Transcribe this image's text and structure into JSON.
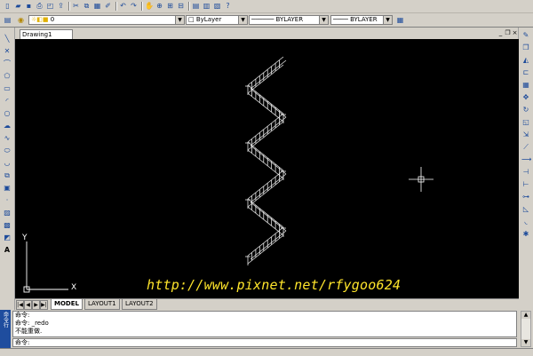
{
  "toolbar": {
    "standard_icons": [
      "new-file-icon",
      "open-icon",
      "save-icon",
      "print-icon",
      "preview-icon",
      "publish-icon",
      "cut-icon",
      "copy-icon",
      "paste-icon",
      "match-properties-icon",
      "undo-icon",
      "redo-icon",
      "pan-icon",
      "zoom-realtime-icon",
      "zoom-window-icon",
      "zoom-previous-icon",
      "properties-icon",
      "design-center-icon",
      "tool-palettes-icon",
      "help-icon"
    ]
  },
  "properties": {
    "layer_value": "0",
    "color_value": "ByLayer",
    "linetype_value": "BYLAYER",
    "lineweight_value": "BYLAYER"
  },
  "drawing_tab": {
    "label": "Drawing1"
  },
  "canvas": {
    "background": "#000000",
    "ucs_x": "X",
    "ucs_y": "Y",
    "watermark": "http://www.pixnet.net/rfygoo624",
    "watermark_color": "#ffe52b"
  },
  "layout_tabs": [
    {
      "label": "MODEL",
      "active": true
    },
    {
      "label": "LAYOUT1",
      "active": false
    },
    {
      "label": "LAYOUT2",
      "active": false
    }
  ],
  "command": {
    "side_label": "命令行",
    "lines": [
      "命令:",
      "命令: _redo",
      "不能重做."
    ],
    "prompt": "命令:"
  }
}
